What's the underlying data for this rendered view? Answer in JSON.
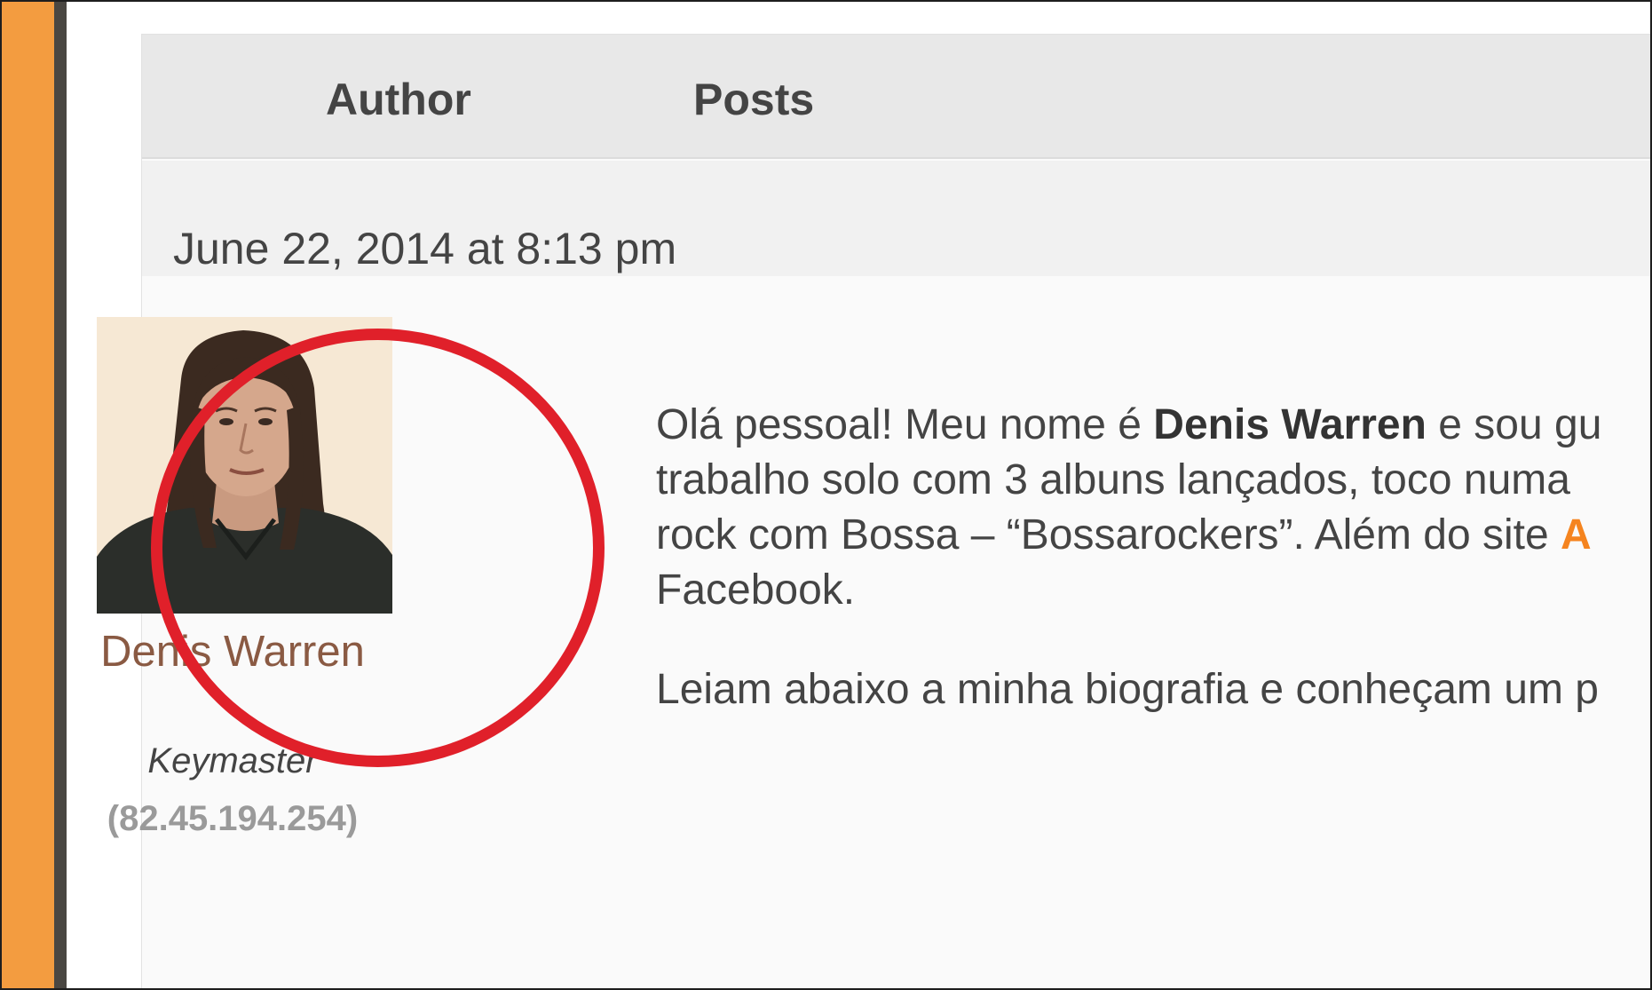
{
  "header": {
    "author_label": "Author",
    "posts_label": "Posts"
  },
  "post": {
    "date": "June 22, 2014 at 8:13 pm",
    "author": {
      "name": "Denis Warren",
      "role": "Keymaster",
      "ip": "(82.45.194.254)"
    },
    "para1": {
      "seg1": "Olá pessoal! Meu nome é ",
      "bold_name": "Denis Warren",
      "seg2": " e sou gu",
      "line2": "trabalho solo com 3 albuns lançados, toco numa",
      "line3_text": "rock com Bossa – “Bossarockers”. Além do site ",
      "line3_link": "A",
      "line4": "Facebook."
    },
    "para2": "Leiam abaixo a minha biografia e conheçam um p"
  },
  "colors": {
    "accent_orange": "#f39c40",
    "highlight_red": "#e0202a",
    "author_link": "#8a5a43",
    "text_link": "#f5841f"
  },
  "icons": {
    "avatar": "user-avatar-photo"
  }
}
